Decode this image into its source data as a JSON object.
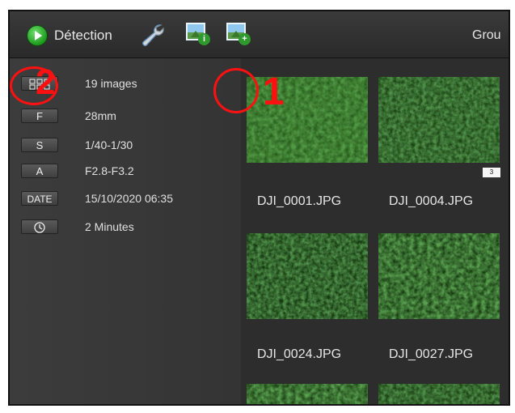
{
  "toolbar": {
    "detection_label": "Détection",
    "group_label": "Grou",
    "icons": [
      "play-icon",
      "wrench-icon",
      "image-info-icon",
      "image-add-icon"
    ],
    "info_badge": "i",
    "add_badge": "+"
  },
  "info_panel": {
    "rows": [
      {
        "chip": "",
        "icon": "grid-icon",
        "value": "19 images"
      },
      {
        "chip": "F",
        "value": "28mm"
      },
      {
        "chip": "S",
        "value": "1/40-1/30"
      },
      {
        "chip": "A",
        "value": "F2.8-F3.2"
      },
      {
        "chip": "DATE",
        "value": "15/10/2020 06:35"
      },
      {
        "chip": "",
        "icon": "clock-icon",
        "value": "2 Minutes"
      }
    ]
  },
  "thumbnails": [
    {
      "filename": "DJI_0001.JPG"
    },
    {
      "filename": "DJI_0004.JPG",
      "badge": "3"
    },
    {
      "filename": "DJI_0024.JPG"
    },
    {
      "filename": "DJI_0027.JPG"
    }
  ],
  "annotations": {
    "marker_1": "1",
    "marker_2": "2",
    "color": "#ff1010"
  },
  "colors": {
    "panel_bg": "#3a3a3a",
    "grid_bg": "#2d2d2d",
    "accent_green": "#1c9a1c"
  }
}
